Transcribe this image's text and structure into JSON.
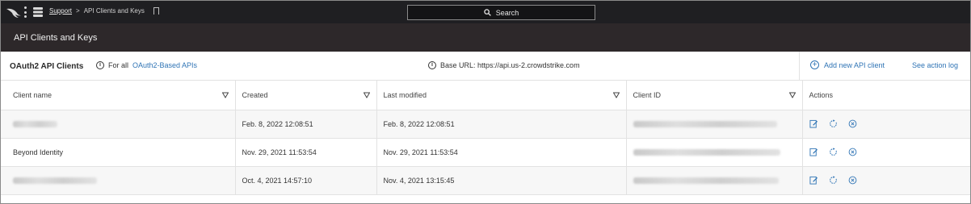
{
  "nav": {
    "breadcrumb_link": "Support",
    "breadcrumb_separator": ">",
    "breadcrumb_current": "API Clients and Keys",
    "search_label": "Search"
  },
  "page": {
    "title": "API Clients and Keys"
  },
  "section": {
    "title": "OAuth2 API Clients",
    "for_all_prefix": "For all",
    "for_all_link": "OAuth2-Based APIs",
    "base_url": "Base URL: https://api.us-2.crowdstrike.com",
    "add_client": "Add new API client",
    "action_log": "See action log"
  },
  "table": {
    "columns": [
      "Client name",
      "Created",
      "Last modified",
      "Client ID",
      "Actions"
    ],
    "rows": [
      {
        "client_name": "",
        "created": "Feb. 8, 2022 12:08:51",
        "last_modified": "Feb. 8, 2022 12:08:51",
        "client_id": ""
      },
      {
        "client_name": "Beyond Identity",
        "created": "Nov. 29, 2021 11:53:54",
        "last_modified": "Nov. 29, 2021 11:53:54",
        "client_id": ""
      },
      {
        "client_name": "",
        "created": "Oct. 4, 2021 14:57:10",
        "last_modified": "Nov. 4, 2021 13:15:45",
        "client_id": ""
      }
    ]
  },
  "colors": {
    "accent": "#2f74b5",
    "topbar": "#1f1f22",
    "titlebar": "#2d282a"
  },
  "icons": [
    "falcon-logo-icon",
    "kebab-menu-icon",
    "apps-icon",
    "bookmark-icon",
    "search-icon",
    "info-icon",
    "plus-circle-icon",
    "filter-icon",
    "edit-icon",
    "reset-icon",
    "delete-icon"
  ]
}
